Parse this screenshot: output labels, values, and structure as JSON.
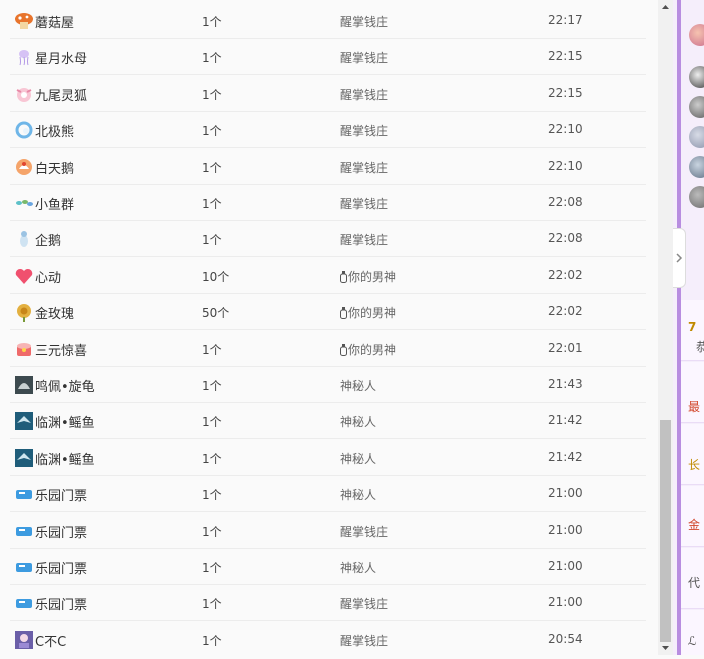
{
  "gifts": [
    {
      "name": "蘑菇屋",
      "count": "1个",
      "sender": "醒掌钱庄",
      "sender_badge": false,
      "time": "22:17",
      "icon": "mushroom-house-icon"
    },
    {
      "name": "星月水母",
      "count": "1个",
      "sender": "醒掌钱庄",
      "sender_badge": false,
      "time": "22:15",
      "icon": "jellyfish-icon"
    },
    {
      "name": "九尾灵狐",
      "count": "1个",
      "sender": "醒掌钱庄",
      "sender_badge": false,
      "time": "22:15",
      "icon": "fox-icon"
    },
    {
      "name": "北极熊",
      "count": "1个",
      "sender": "醒掌钱庄",
      "sender_badge": false,
      "time": "22:10",
      "icon": "polar-bear-icon"
    },
    {
      "name": "白天鹅",
      "count": "1个",
      "sender": "醒掌钱庄",
      "sender_badge": false,
      "time": "22:10",
      "icon": "swan-icon"
    },
    {
      "name": "小鱼群",
      "count": "1个",
      "sender": "醒掌钱庄",
      "sender_badge": false,
      "time": "22:08",
      "icon": "fish-school-icon"
    },
    {
      "name": "企鹅",
      "count": "1个",
      "sender": "醒掌钱庄",
      "sender_badge": false,
      "time": "22:08",
      "icon": "penguin-icon"
    },
    {
      "name": "心动",
      "count": "10个",
      "sender": "你的男神",
      "sender_badge": true,
      "time": "22:02",
      "icon": "heart-icon"
    },
    {
      "name": "金玫瑰",
      "count": "50个",
      "sender": "你的男神",
      "sender_badge": true,
      "time": "22:02",
      "icon": "gold-rose-icon"
    },
    {
      "name": "三元惊喜",
      "count": "1个",
      "sender": "你的男神",
      "sender_badge": true,
      "time": "22:01",
      "icon": "surprise-box-icon"
    },
    {
      "name": "鸣佩•旋龟",
      "count": "1个",
      "sender": "神秘人",
      "sender_badge": false,
      "time": "21:43",
      "icon": "turtle-icon"
    },
    {
      "name": "临渊•鳐鱼",
      "count": "1个",
      "sender": "神秘人",
      "sender_badge": false,
      "time": "21:42",
      "icon": "ray-fish-icon"
    },
    {
      "name": "临渊•鳐鱼",
      "count": "1个",
      "sender": "神秘人",
      "sender_badge": false,
      "time": "21:42",
      "icon": "ray-fish-icon"
    },
    {
      "name": "乐园门票",
      "count": "1个",
      "sender": "神秘人",
      "sender_badge": false,
      "time": "21:00",
      "icon": "ticket-icon"
    },
    {
      "name": "乐园门票",
      "count": "1个",
      "sender": "醒掌钱庄",
      "sender_badge": false,
      "time": "21:00",
      "icon": "ticket-icon"
    },
    {
      "name": "乐园门票",
      "count": "1个",
      "sender": "神秘人",
      "sender_badge": false,
      "time": "21:00",
      "icon": "ticket-icon"
    },
    {
      "name": "乐园门票",
      "count": "1个",
      "sender": "醒掌钱庄",
      "sender_badge": false,
      "time": "21:00",
      "icon": "ticket-icon"
    },
    {
      "name": "C不C",
      "count": "1个",
      "sender": "醒掌钱庄",
      "sender_badge": false,
      "time": "20:54",
      "icon": "c-bu-c-icon"
    }
  ],
  "side_panel": {
    "fragments": [
      "7",
      "恭",
      "最",
      "长",
      "金",
      "代",
      "ℒ"
    ],
    "accent": "#b88de0"
  }
}
